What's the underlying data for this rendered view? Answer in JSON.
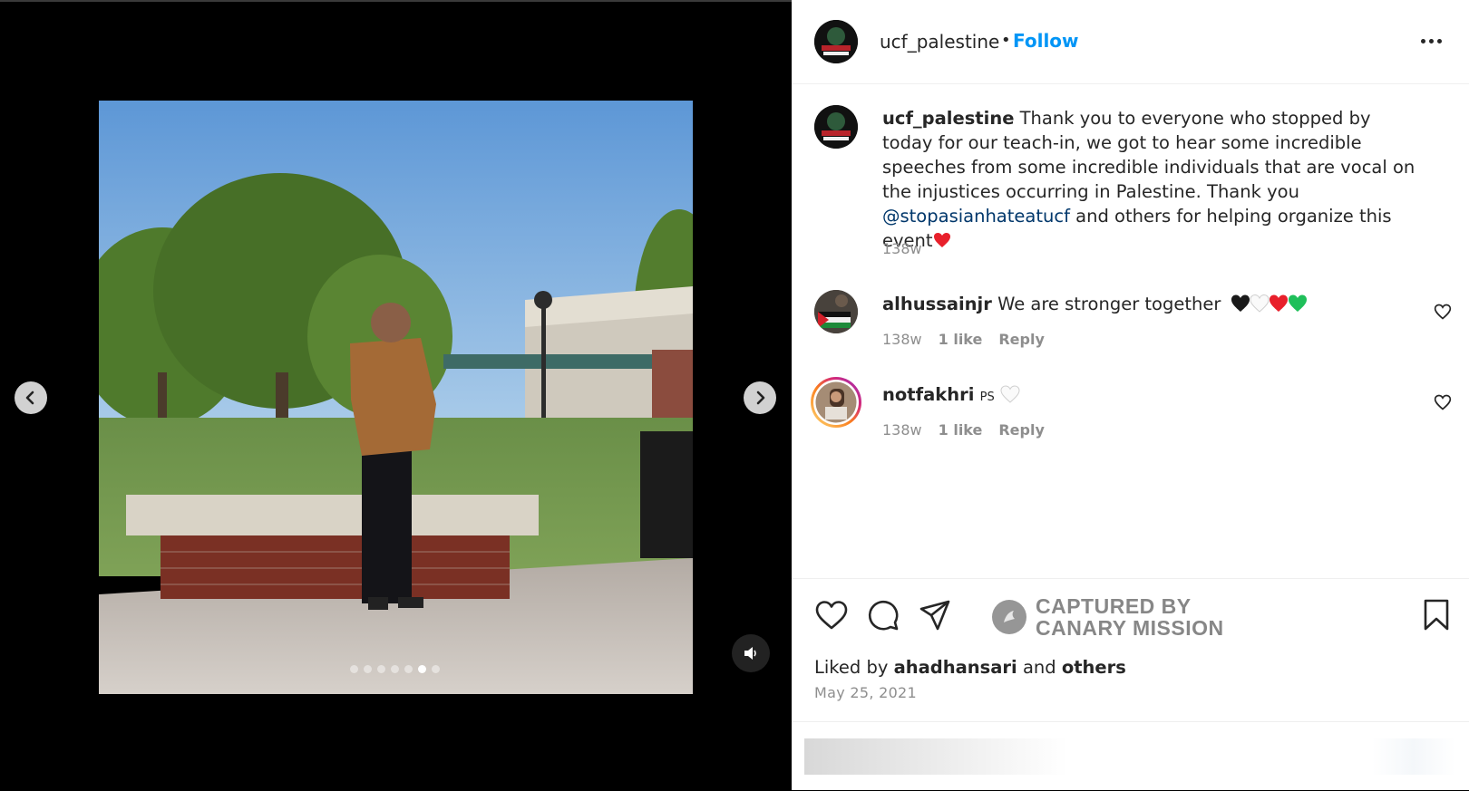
{
  "post": {
    "username": "ucf_palestine",
    "separator": "•",
    "follow_label": "Follow",
    "media": {
      "carousel_total": 7,
      "carousel_active_index": 5
    }
  },
  "caption": {
    "username": "ucf_palestine",
    "text_before_mention": " Thank you to everyone who stopped by today for our teach-in, we got to hear some incredible speeches from some incredible individuals that are vocal on the injustices occurring in Palestine. Thank you ",
    "mention": "@stopasianhateatucf",
    "text_after_mention": " and others for helping organize this event",
    "time": "138w"
  },
  "comments": [
    {
      "username": "alhussainjr",
      "text": "We are stronger together",
      "time": "138w",
      "likes": "1 like",
      "reply_label": "Reply"
    },
    {
      "username": "notfakhri",
      "text": "PS",
      "time": "138w",
      "likes": "1 like",
      "reply_label": "Reply"
    }
  ],
  "watermark": {
    "line1": "CAPTURED BY",
    "line2": "CANARY MISSION"
  },
  "likes": {
    "prefix": "Liked by",
    "user": "ahadhansari",
    "middle": "and",
    "suffix": "others"
  },
  "date": "May 25, 2021",
  "colors": {
    "follow": "#0095f6",
    "mention": "#00376b",
    "meta": "#8e8e8e",
    "text": "#262626"
  },
  "icons": [
    "chevron-left-icon",
    "chevron-right-icon",
    "audio-icon",
    "more-icon",
    "heart-icon",
    "comment-icon",
    "share-icon",
    "bookmark-icon"
  ]
}
